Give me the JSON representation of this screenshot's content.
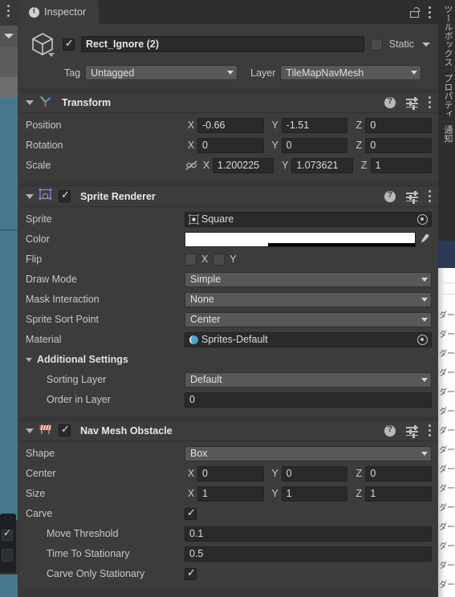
{
  "window": {
    "tab_label": "Inspector",
    "tab_icon": "info-icon",
    "lock_icon": "lock-open-icon",
    "menu_icon": "kebab-menu-icon"
  },
  "object_header": {
    "icon": "cube-icon",
    "enabled": true,
    "name": "Rect_Ignore (2)",
    "static_label": "Static",
    "static_checked": false,
    "tag_label": "Tag",
    "tag_value": "Untagged",
    "layer_label": "Layer",
    "layer_value": "TileMapNavMesh"
  },
  "components": [
    {
      "id": "transform",
      "title": "Transform",
      "icon": "transform-axis-icon",
      "has_checkbox": false,
      "expanded": true,
      "rows": [
        {
          "type": "vector3",
          "label": "Position",
          "x": "-0.66",
          "y": "-1.51",
          "z": "0"
        },
        {
          "type": "vector3",
          "label": "Rotation",
          "x": "0",
          "y": "0",
          "z": "0"
        },
        {
          "type": "vector3",
          "label": "Scale",
          "x": "1.200225",
          "y": "1.073621",
          "z": "1",
          "link_icon": "unlinked-scale-icon"
        }
      ]
    },
    {
      "id": "sprite-renderer",
      "title": "Sprite Renderer",
      "icon": "sprite-renderer-icon",
      "has_checkbox": true,
      "enabled": true,
      "expanded": true,
      "rows": [
        {
          "type": "object",
          "label": "Sprite",
          "value": "Square",
          "thumb": "sprite-thumb-icon"
        },
        {
          "type": "color",
          "label": "Color",
          "value": "#FFFFFF",
          "eyedropper": "eyedropper-icon"
        },
        {
          "type": "flip",
          "label": "Flip",
          "x_label": "X",
          "y_label": "Y",
          "x_checked": false,
          "y_checked": false
        },
        {
          "type": "dropdown",
          "label": "Draw Mode",
          "value": "Simple"
        },
        {
          "type": "dropdown",
          "label": "Mask Interaction",
          "value": "None"
        },
        {
          "type": "dropdown",
          "label": "Sprite Sort Point",
          "value": "Center"
        },
        {
          "type": "object",
          "label": "Material",
          "value": "Sprites-Default",
          "thumb": "material-sphere-icon"
        },
        {
          "type": "subheader",
          "label": "Additional Settings"
        },
        {
          "type": "dropdown",
          "label": "Sorting Layer",
          "value": "Default",
          "indent": true
        },
        {
          "type": "text",
          "label": "Order in Layer",
          "value": "0",
          "indent": true
        }
      ]
    },
    {
      "id": "nav-mesh-obstacle",
      "title": "Nav Mesh Obstacle",
      "icon": "nav-mesh-obstacle-icon",
      "has_checkbox": true,
      "enabled": true,
      "expanded": true,
      "rows": [
        {
          "type": "dropdown",
          "label": "Shape",
          "value": "Box"
        },
        {
          "type": "vector3",
          "label": "Center",
          "x": "0",
          "y": "0",
          "z": "0"
        },
        {
          "type": "vector3",
          "label": "Size",
          "x": "1",
          "y": "1",
          "z": "1"
        },
        {
          "type": "checkbox",
          "label": "Carve",
          "checked": true
        },
        {
          "type": "text",
          "label": "Move Threshold",
          "value": "0.1",
          "indent": true
        },
        {
          "type": "text",
          "label": "Time To Stationary",
          "value": "0.5",
          "indent": true
        },
        {
          "type": "checkbox",
          "label": "Carve Only Stationary",
          "checked": true,
          "indent": true
        }
      ]
    }
  ],
  "axis_labels": {
    "x": "X",
    "y": "Y",
    "z": "Z"
  },
  "right_dock": {
    "tabs": [
      "ツールボックス",
      "プロパティ",
      "通知"
    ],
    "list_item": "ダー"
  },
  "colors": {
    "panel_bg": "#3c3c3c",
    "window_bg": "#383838",
    "field_bg": "#2a2a2a",
    "dropdown_bg": "#585858",
    "text": "#c8c8c8",
    "scene_teal": "#46788c",
    "sprite_icon": "#a07cdc",
    "obstacle_icon": "#e8623c"
  }
}
